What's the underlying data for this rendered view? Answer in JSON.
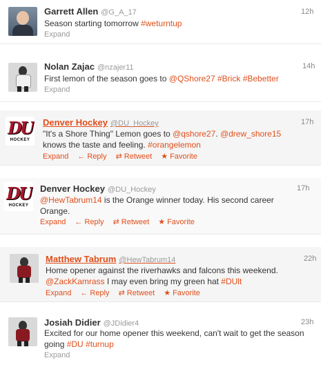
{
  "tweets": [
    {
      "name": "Garrett Allen",
      "handle": "@G_A_17",
      "time": "12h",
      "segments": [
        {
          "text": "Season starting tomorrow ",
          "hl": false
        },
        {
          "text": "#weturntup",
          "hl": true
        }
      ],
      "actions": {
        "expand": "Expand"
      }
    },
    {
      "name": "Nolan Zajac",
      "handle": "@nzajer11",
      "time": "14h",
      "segments": [
        {
          "text": "First lemon of the season goes to ",
          "hl": false
        },
        {
          "text": "@QShore27",
          "hl": true
        },
        {
          "text": " ",
          "hl": false
        },
        {
          "text": "#Brick",
          "hl": true
        },
        {
          "text": " ",
          "hl": false
        },
        {
          "text": "#Bebetter",
          "hl": true
        }
      ],
      "actions": {
        "expand": "Expand"
      }
    },
    {
      "name": "Denver Hockey",
      "handle": "@DU_Hockey",
      "time": "17h",
      "segments": [
        {
          "text": "\"It's a Shore Thing\" Lemon goes to ",
          "hl": false
        },
        {
          "text": "@qshore27",
          "hl": true
        },
        {
          "text": ". ",
          "hl": false
        },
        {
          "text": "@drew_shore15",
          "hl": true
        },
        {
          "text": " knows the taste and feeling. ",
          "hl": false
        },
        {
          "text": "#orangelemon",
          "hl": true
        }
      ],
      "actions": {
        "expand": "Expand",
        "reply": "Reply",
        "retweet": "Retweet",
        "favorite": "Favorite"
      }
    },
    {
      "name": "Denver Hockey",
      "handle": "@DU_Hockey",
      "time": "17h",
      "segments": [
        {
          "text": "@HewTabrum14",
          "hl": true
        },
        {
          "text": " is the Orange winner today. His second career Orange.",
          "hl": false
        }
      ],
      "actions": {
        "expand": "Expand",
        "reply": "Reply",
        "retweet": "Retweet",
        "favorite": "Favorite"
      }
    },
    {
      "name": "Matthew Tabrum",
      "handle": "@HewTabrum14",
      "time": "22h",
      "segments": [
        {
          "text": "Home opener against the riverhawks and falcons this weekend. ",
          "hl": false
        },
        {
          "text": "@ZackKamrass",
          "hl": true
        },
        {
          "text": " I may even bring my green hat ",
          "hl": false
        },
        {
          "text": "#DUlt",
          "hl": true
        }
      ],
      "actions": {
        "expand": "Expand",
        "reply": "Reply",
        "retweet": "Retweet",
        "favorite": "Favorite"
      }
    },
    {
      "name": "Josiah Didier",
      "handle": "@JDidier4",
      "time": "23h",
      "segments": [
        {
          "text": "Excited for our home opener this weekend, can't wait to get the season going ",
          "hl": false
        },
        {
          "text": "#DU",
          "hl": true
        },
        {
          "text": " ",
          "hl": false
        },
        {
          "text": "#turnup",
          "hl": true
        }
      ],
      "actions": {
        "expand": "Expand"
      }
    }
  ],
  "logo": {
    "du_text": "DU",
    "hockey_text": "HOCKEY"
  },
  "icons": {
    "reply": "reply-arrow-icon",
    "retweet": "retweet-icon",
    "favorite": "star-icon"
  },
  "colors": {
    "link": "#e04e1b",
    "highlight_bg": "#f5f5f5"
  }
}
